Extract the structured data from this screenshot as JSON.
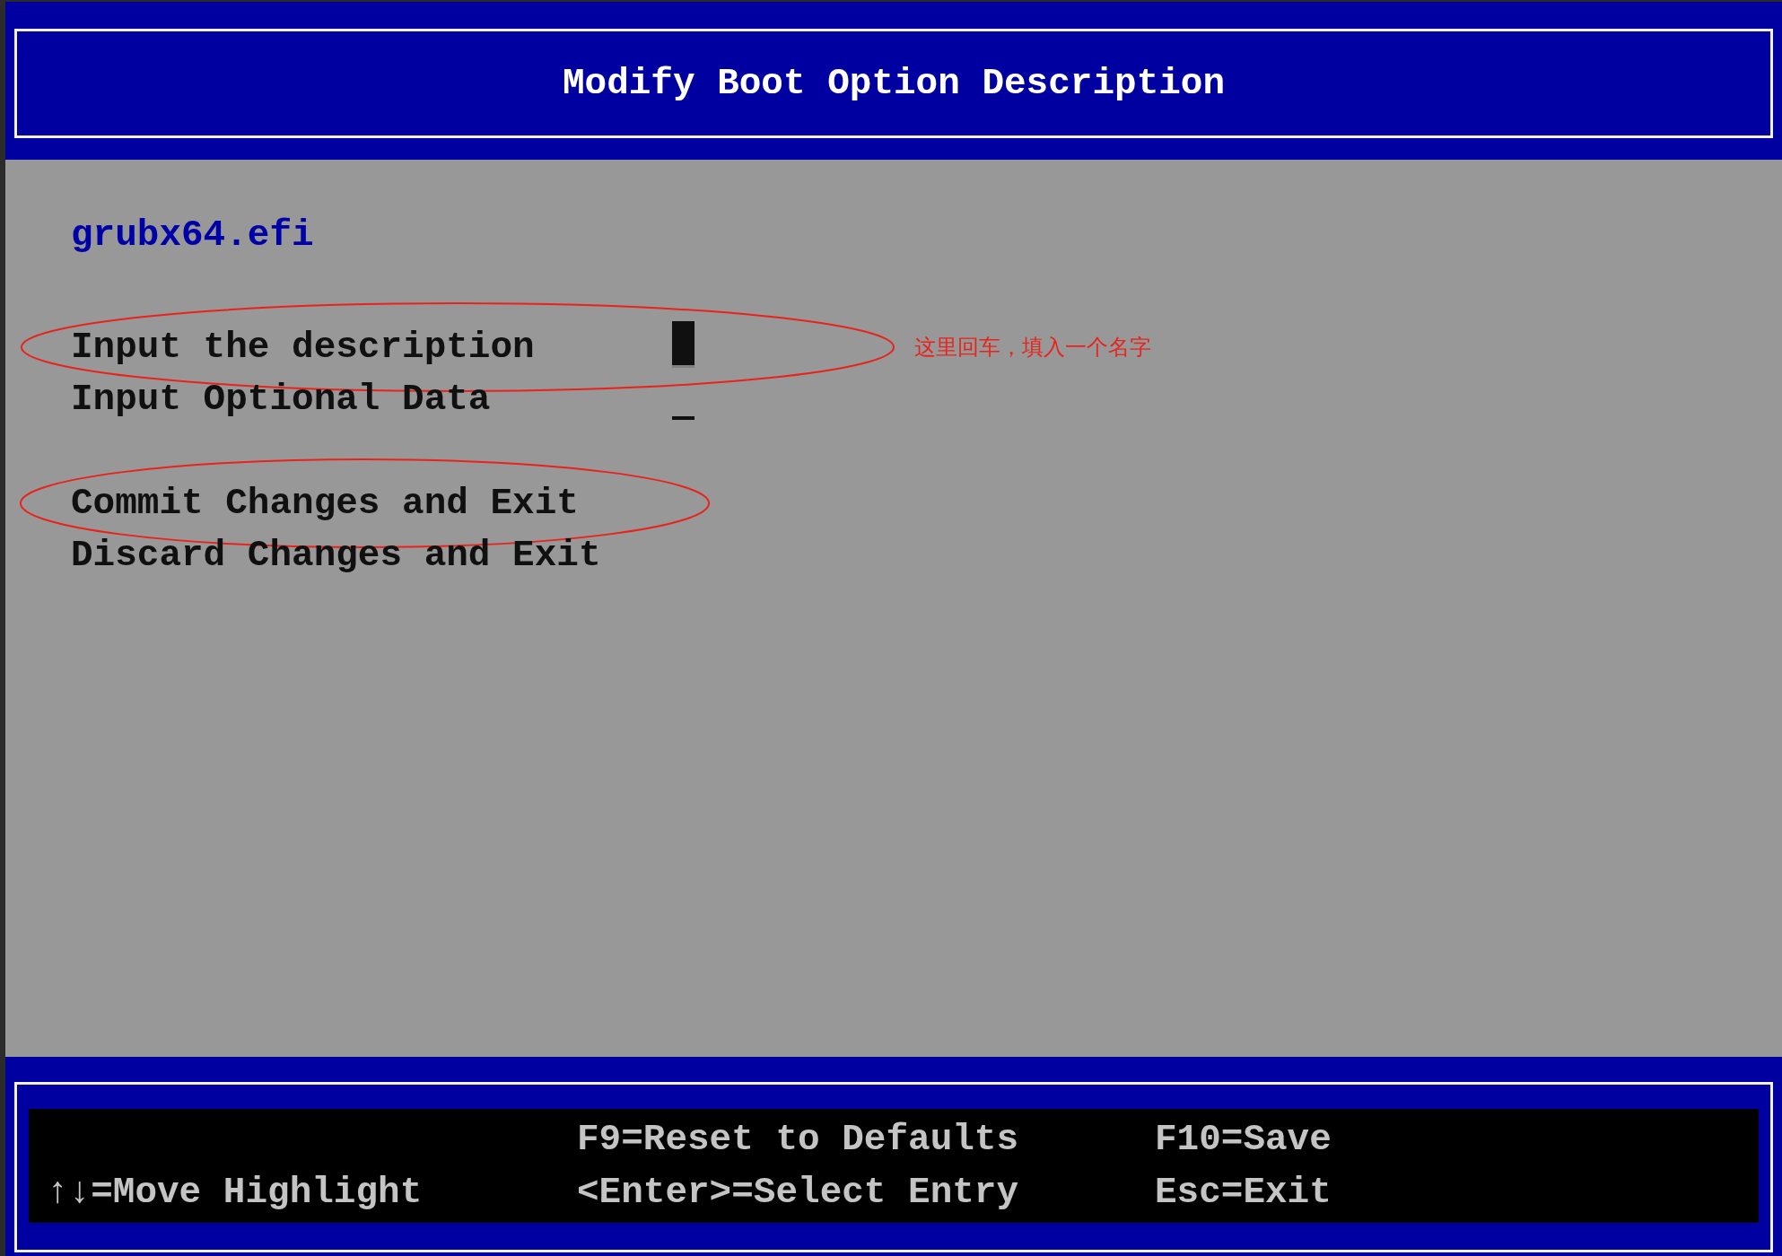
{
  "header": {
    "title": "Modify Boot Option Description"
  },
  "boot_file": "grubx64.efi",
  "menu": [
    {
      "kind": "field",
      "label": "Input the description",
      "selected": true,
      "circled": true,
      "note": "这里回车，填入一个名字"
    },
    {
      "kind": "field",
      "label": "Input Optional Data",
      "selected": false,
      "circled": false
    },
    {
      "kind": "action",
      "label": "Commit Changes and Exit",
      "selected": false,
      "circled": true
    },
    {
      "kind": "action",
      "label": "Discard Changes and Exit",
      "selected": false,
      "circled": false
    }
  ],
  "footer": {
    "columns": [
      {
        "lines": [
          "↑↓=Move Highlight"
        ]
      },
      {
        "lines": [
          "F9=Reset to Defaults",
          "<Enter>=Select Entry"
        ]
      },
      {
        "lines": [
          "F10=Save",
          "Esc=Exit"
        ]
      }
    ]
  }
}
